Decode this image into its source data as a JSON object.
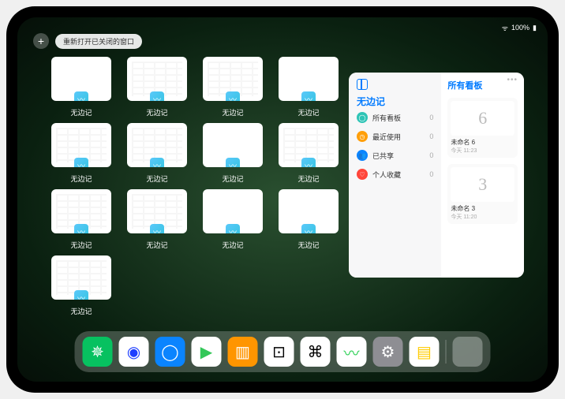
{
  "statusbar": {
    "time": "",
    "battery": "100%"
  },
  "topbar": {
    "add": "+",
    "reopen": "重新打开已关闭的窗口"
  },
  "thumb_label": "无边记",
  "thumbs": [
    {
      "variant": "blank"
    },
    {
      "variant": "grid"
    },
    {
      "variant": "grid"
    },
    {
      "variant": "blank"
    },
    {
      "variant": "grid"
    },
    {
      "variant": "grid"
    },
    {
      "variant": "blank"
    },
    {
      "variant": "grid"
    },
    {
      "variant": "grid"
    },
    {
      "variant": "grid"
    },
    {
      "variant": "blank"
    },
    {
      "variant": "blank"
    },
    {
      "variant": "grid"
    }
  ],
  "panel": {
    "title": "无边记",
    "items": [
      {
        "icon": "◯",
        "color": "#2ec4b6",
        "label": "所有看板",
        "count": 0
      },
      {
        "icon": "◷",
        "color": "#ff9f0a",
        "label": "最近使用",
        "count": 0
      },
      {
        "icon": "👥",
        "color": "#0a84ff",
        "label": "已共享",
        "count": 0
      },
      {
        "icon": "♡",
        "color": "#ff453a",
        "label": "个人收藏",
        "count": 0
      }
    ],
    "right_title": "所有看板",
    "boards": [
      {
        "sketch": "6",
        "name": "未命名 6",
        "time": "今天 11:23"
      },
      {
        "sketch": "3",
        "name": "未命名 3",
        "time": "今天 11:20"
      }
    ]
  },
  "dock": [
    {
      "name": "wechat",
      "bg": "#07c160",
      "glyph": "✵"
    },
    {
      "name": "quark",
      "bg": "#fff",
      "glyph": "◉",
      "fg": "#1e3fff"
    },
    {
      "name": "qqbrowser",
      "bg": "#0a84ff",
      "glyph": "◯"
    },
    {
      "name": "play",
      "bg": "#fff",
      "glyph": "▶",
      "fg": "#34c759"
    },
    {
      "name": "books",
      "bg": "#ff9500",
      "glyph": "▥"
    },
    {
      "name": "dice",
      "bg": "#fff",
      "glyph": "⊡",
      "fg": "#000"
    },
    {
      "name": "app7",
      "bg": "#fff",
      "glyph": "⌘",
      "fg": "#000"
    },
    {
      "name": "freeform",
      "bg": "#fff",
      "glyph": "〰",
      "fg": "#30d158"
    },
    {
      "name": "settings",
      "bg": "#8e8e93",
      "glyph": "⚙"
    },
    {
      "name": "notes",
      "bg": "#fff",
      "glyph": "▤",
      "fg": "#ffcc00"
    }
  ]
}
